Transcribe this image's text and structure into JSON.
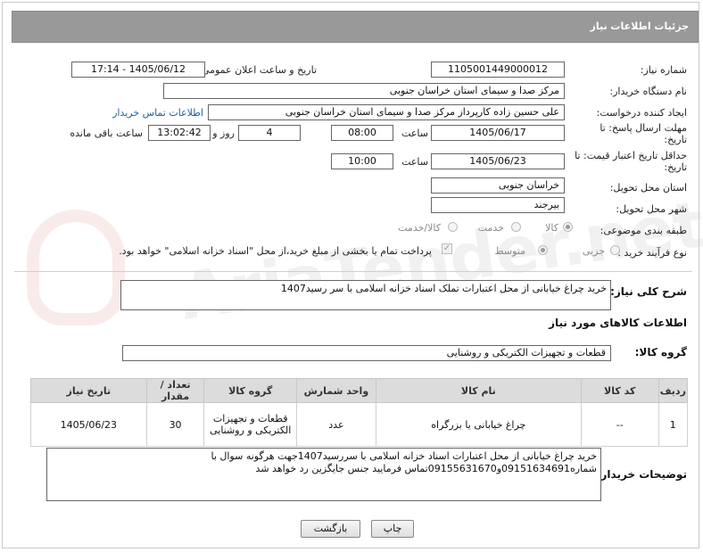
{
  "page_title": "جزئیات اطلاعات نیاز",
  "fields": {
    "need_number_label": "شماره نیاز:",
    "need_number": "1105001449000012",
    "announce_label": "تاریخ و ساعت اعلان عمومی:",
    "announce_value": "1405/06/12 - 17:14",
    "buyer_org_label": "نام دستگاه خریدار:",
    "buyer_org": "مرکز صدا و سیمای استان خراسان جنوبی",
    "creator_label": "ایجاد کننده درخواست:",
    "creator": "علی حسین زاده کارپرداز مرکز صدا و سیمای استان خراسان جنوبی",
    "contact_link": "اطلاعات تماس خریدار",
    "deadline_label": "مهلت ارسال پاسخ: تا تاریخ:",
    "deadline_date": "1405/06/17",
    "time_label": "ساعت",
    "deadline_time": "08:00",
    "days": "4",
    "days_label": "روز و",
    "remaining": "13:02:42",
    "remaining_label": "ساعت باقی مانده",
    "validity_label": "حداقل تاریخ اعتبار قیمت: تا تاریخ:",
    "validity_date": "1405/06/23",
    "validity_time": "10:00",
    "province_label": "استان محل تحویل:",
    "province": "خراسان جنوبی",
    "city_label": "شهر محل تحویل:",
    "city": "بیرجند",
    "category_label": "طبقه بندی موضوعی:",
    "category_options": [
      "کالا",
      "خدمت",
      "کالا/خدمت"
    ],
    "process_label": "نوع فرآیند خرید :",
    "process_options": [
      "جزیی",
      "متوسط"
    ],
    "payment_note": "پرداخت تمام یا بخشی از مبلغ خرید،از محل \"اسناد خزانه اسلامی\" خواهد بود."
  },
  "description_label": "شرح کلی نیاز:",
  "description": "خرید چراغ خیابانی از محل اعتبارات تملک اسناد خزانه اسلامی با سر رسید1407",
  "items_section_title": "اطلاعات کالاهای مورد نیاز",
  "goods_group_label": "گروه کالا:",
  "goods_group": "قطعات و تجهیزات الکتریکی و روشنایی",
  "table": {
    "headers": [
      "ردیف",
      "کد کالا",
      "نام کالا",
      "واحد شمارش",
      "گروه کالا",
      "تعداد / مقدار",
      "تاریخ نیاز"
    ],
    "rows": [
      [
        "1",
        "--",
        "چراغ خیابانی یا بزرگراه",
        "عدد",
        "قطعات و تجهیزات الکتریکی و روشنایی",
        "30",
        "1405/06/23"
      ]
    ]
  },
  "buyer_notes_label": "توضیحات خریدار:",
  "buyer_notes": "خرید چراغ خیابانی از محل اعتبارات اسناد خزانه اسلامی با سررسید1407جهت هرگونه سوال با شماره09151634691و09155631670تماس فرمایید جنس جایگزین رد خواهد شد",
  "buttons": {
    "print": "چاپ",
    "back": "بازگشت"
  },
  "colors": {
    "title_bar": "#999999",
    "link": "#1f5fa8"
  }
}
